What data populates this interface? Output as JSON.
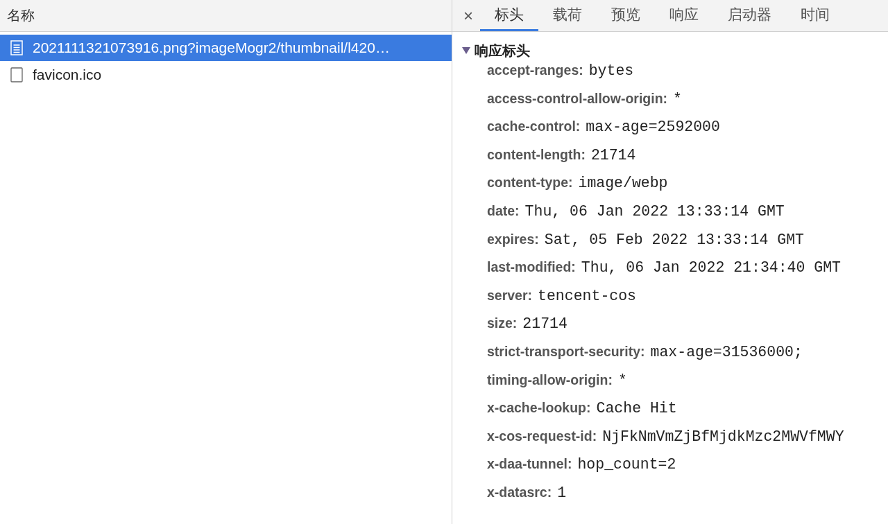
{
  "requests": {
    "column": "名称",
    "rows": [
      {
        "name": "2021111321073916.png?imageMogr2/thumbnail/l420…",
        "kind": "document",
        "selected": true
      },
      {
        "name": "favicon.ico",
        "kind": "blank",
        "selected": false
      }
    ]
  },
  "details": {
    "close": "×",
    "tabs": [
      {
        "label": "标头",
        "selected": true
      },
      {
        "label": "载荷",
        "selected": false
      },
      {
        "label": "预览",
        "selected": false
      },
      {
        "label": "响应",
        "selected": false
      },
      {
        "label": "启动器",
        "selected": false
      },
      {
        "label": "时间",
        "selected": false
      }
    ],
    "section": {
      "title": "响应标头",
      "expanded": true,
      "headers": [
        {
          "key": "accept-ranges:",
          "value": "bytes"
        },
        {
          "key": "access-control-allow-origin:",
          "value": "*"
        },
        {
          "key": "cache-control:",
          "value": "max-age=2592000"
        },
        {
          "key": "content-length:",
          "value": "21714"
        },
        {
          "key": "content-type:",
          "value": "image/webp"
        },
        {
          "key": "date:",
          "value": "Thu, 06 Jan 2022 13:33:14 GMT"
        },
        {
          "key": "expires:",
          "value": "Sat, 05 Feb 2022 13:33:14 GMT"
        },
        {
          "key": "last-modified:",
          "value": "Thu, 06 Jan 2022 21:34:40 GMT"
        },
        {
          "key": "server:",
          "value": "tencent-cos"
        },
        {
          "key": "size:",
          "value": "21714"
        },
        {
          "key": "strict-transport-security:",
          "value": "max-age=31536000;"
        },
        {
          "key": "timing-allow-origin:",
          "value": "*"
        },
        {
          "key": "x-cache-lookup:",
          "value": "Cache Hit"
        },
        {
          "key": "x-cos-request-id:",
          "value": "NjFkNmVmZjBfMjdkMzc2MWVfMWY"
        },
        {
          "key": "x-daa-tunnel:",
          "value": "hop_count=2"
        },
        {
          "key": "x-datasrc:",
          "value": "1"
        }
      ]
    }
  }
}
